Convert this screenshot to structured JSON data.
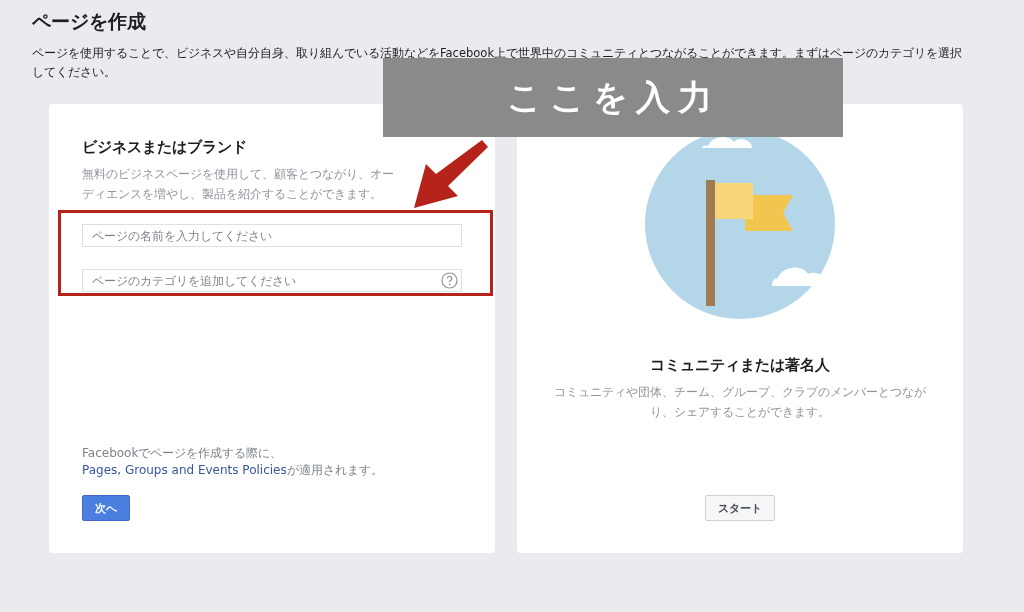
{
  "page": {
    "title": "ページを作成",
    "description": "ページを使用することで、ビジネスや自分自身、取り組んでいる活動などをFacebook上で世界中のコミュニティとつながることができます。まずはページのカテゴリを選択してください。"
  },
  "annotation": {
    "label": "ここを入力"
  },
  "cards": [
    {
      "kind": "form",
      "title": "ビジネスまたはブランド",
      "description": "無料のビジネスページを使用して、顧客とつながり、オーディエンスを増やし、製品を紹介することができます。",
      "fields": [
        {
          "placeholder": "ページの名前を入力してください",
          "help": false
        },
        {
          "placeholder": "ページのカテゴリを追加してください",
          "help": true
        }
      ],
      "footer": {
        "before": "Facebookでページを作成する際に、",
        "link": "Pages, Groups and Events Policies",
        "after": "が適用されます。"
      },
      "button": "次へ"
    },
    {
      "kind": "illustrated",
      "title": "コミュニティまたは著名人",
      "description": "コミュニティや団体、チーム、グループ、クラブのメンバーとつながり、シェアすることができます。",
      "button": "スタート"
    }
  ]
}
